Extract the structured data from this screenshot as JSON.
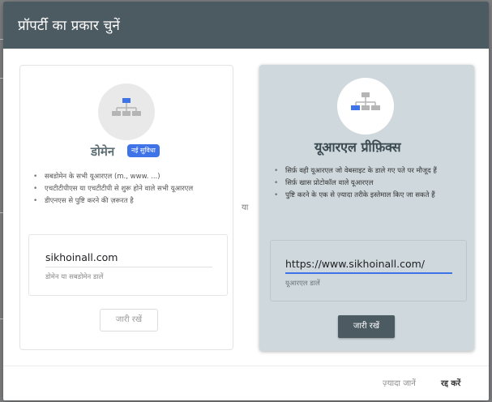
{
  "dialog": {
    "title": "प्रॉपर्टी का प्रकार चुनें",
    "header_color": "#4c5a62",
    "or_label": "या"
  },
  "domain_card": {
    "icon": "sitemap-icon",
    "title": "डोमेन",
    "badge": "नई सुविधा",
    "bullets": [
      "सबडोमेन के सभी यूआरएल (m., www. ...)",
      "एचटीटीपीएस या एचटीटीपी से शुरू होने वाले सभी यूआरएल",
      "डीएनएस से पुष्टि करने की ज़रूरत है"
    ],
    "input": {
      "value": "sikhoinall.com",
      "hint": "डोमेन या सबडोमेन डालें"
    },
    "continue_label": "जारी रखें"
  },
  "prefix_card": {
    "icon": "sitemap-icon",
    "title": "यूआरएल प्रीफ़िक्स",
    "bullets": [
      "सिर्फ़ वही यूआरएल जो वेबसाइट के डाले गए पते पर मौजूद हैं",
      "सिर्फ़ खास प्रोटोकॉल वाले यूआरएल",
      "पुष्टि करने के एक से ज़्यादा तरीके इस्तेमाल किए जा सकते हैं"
    ],
    "input": {
      "value": "https://www.sikhoinall.com/",
      "hint": "यूआरएल डालें"
    },
    "continue_label": "जारी रखें"
  },
  "footer": {
    "learn_more": "ज़्यादा जानें",
    "cancel": "रद्द करें"
  },
  "colors": {
    "accent": "#3f73e8",
    "selected_card": "#cfd8dc"
  }
}
